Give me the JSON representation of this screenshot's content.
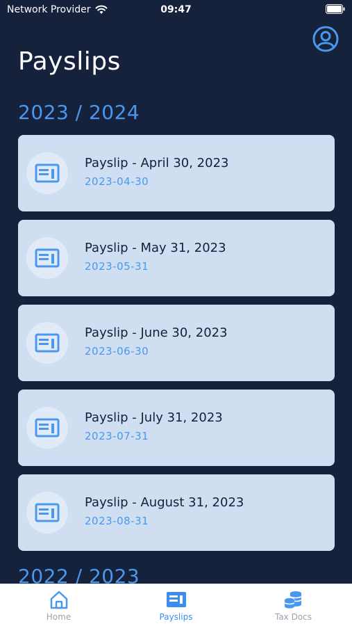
{
  "status_bar": {
    "carrier": "Network Provider",
    "time": "09:47"
  },
  "header": {
    "title": "Payslips"
  },
  "sections": [
    {
      "heading": "2023 / 2024",
      "payslips": [
        {
          "title": "Payslip - April 30, 2023",
          "date": "2023-04-30"
        },
        {
          "title": "Payslip - May 31, 2023",
          "date": "2023-05-31"
        },
        {
          "title": "Payslip - June 30, 2023",
          "date": "2023-06-30"
        },
        {
          "title": "Payslip - July 31, 2023",
          "date": "2023-07-31"
        },
        {
          "title": "Payslip - August 31, 2023",
          "date": "2023-08-31"
        }
      ]
    },
    {
      "heading": "2022 / 2023"
    }
  ],
  "tab_bar": {
    "tabs": [
      {
        "label": "Home",
        "icon": "home-icon"
      },
      {
        "label": "Payslips",
        "icon": "payslip-icon",
        "active": true
      },
      {
        "label": "Tax Docs",
        "icon": "coins-icon"
      }
    ]
  },
  "colors": {
    "background": "#16213c",
    "accent": "#4a98ee",
    "card": "#cfdff1",
    "active_tab": "#3d8cf0",
    "inactive_tab": "#9aa3ad"
  }
}
